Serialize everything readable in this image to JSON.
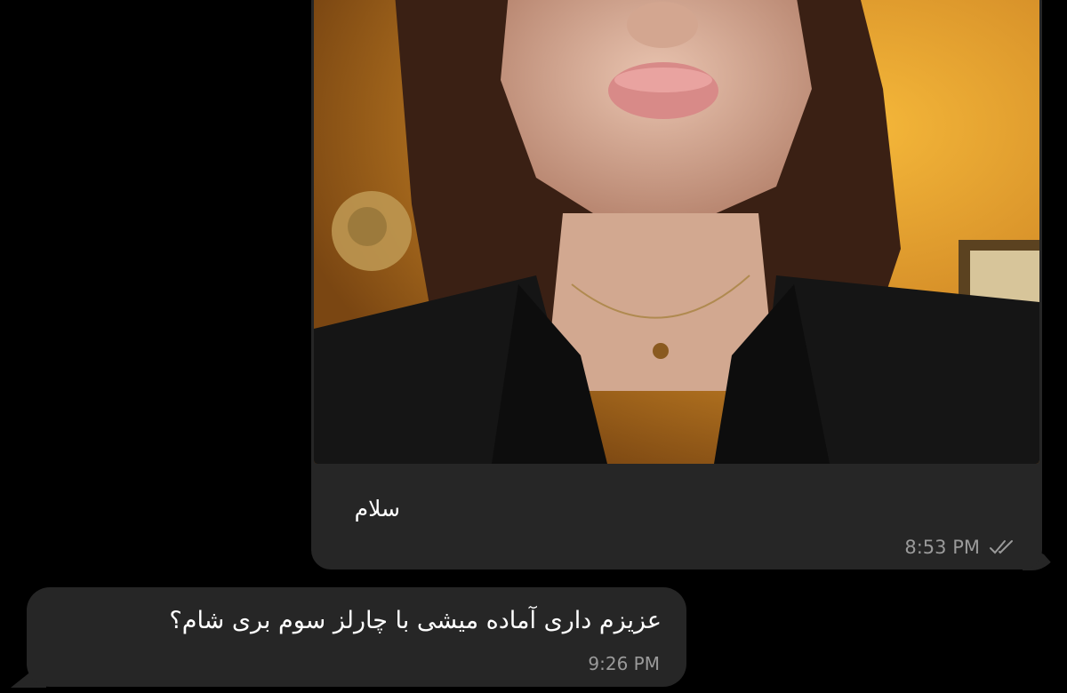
{
  "messages": [
    {
      "direction": "outgoing",
      "caption": "سلام",
      "time": "8:53 PM",
      "status_icon": "double-check-icon",
      "has_photo": true
    },
    {
      "direction": "incoming",
      "text": "عزیزم داری آماده میشی با چارلز سوم بری شام؟",
      "time": "9:26 PM"
    }
  ],
  "colors": {
    "background": "#000000",
    "bubble": "#262626",
    "text": "#ffffff",
    "meta_text": "#9a9a9a"
  }
}
